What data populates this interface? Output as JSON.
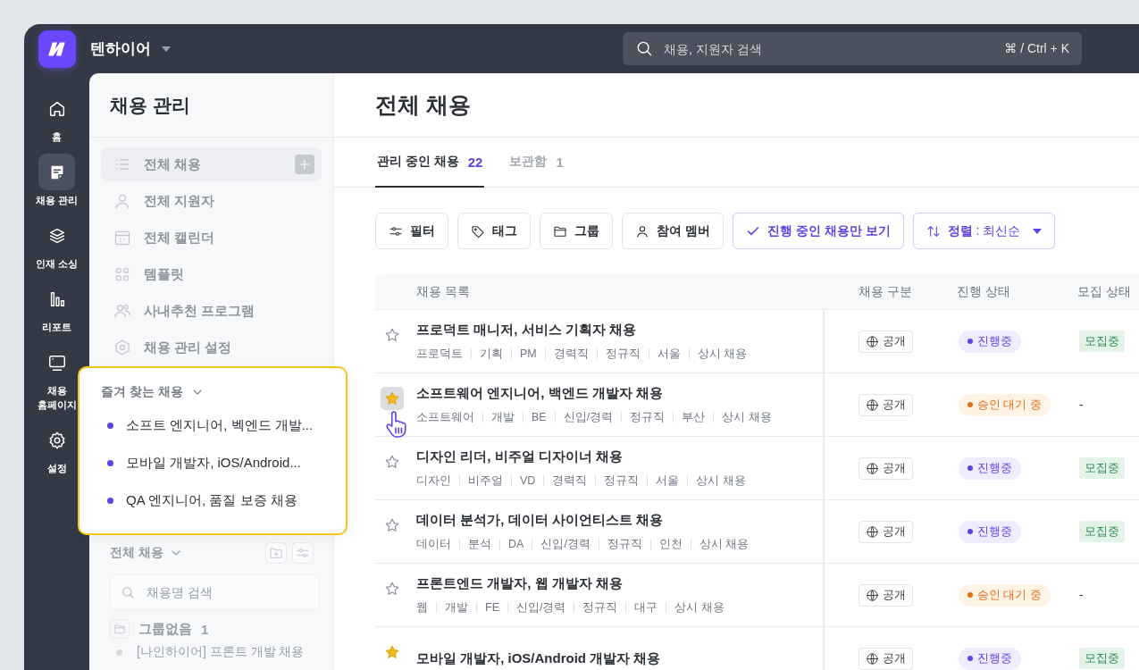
{
  "topbar": {
    "workspace": "텐하이어",
    "search": {
      "placeholder": "채용, 지원자 검색",
      "shortcut": "⌘ / Ctrl + K"
    }
  },
  "rail": [
    {
      "label": "홈",
      "selected": false
    },
    {
      "label": "채용 관리",
      "selected": true
    },
    {
      "label": "인재 소싱",
      "selected": false
    },
    {
      "label": "리포트",
      "selected": false
    },
    {
      "label": "채용 홈페이지",
      "selected": false
    },
    {
      "label": "설정",
      "selected": false
    }
  ],
  "sidebar": {
    "title": "채용 관리",
    "items": [
      {
        "label": "전체 채용",
        "selected": true
      },
      {
        "label": "전체 지원자",
        "selected": false
      },
      {
        "label": "전체 캘린더",
        "selected": false
      },
      {
        "label": "템플릿",
        "selected": false
      },
      {
        "label": "사내추천 프로그램",
        "selected": false
      },
      {
        "label": "채용 관리 설정",
        "selected": false
      }
    ],
    "favorites": {
      "title": "즐겨 찾는 채용",
      "expanded": true,
      "items": [
        "소프트 엔지니어, 벡엔드 개발...",
        "모바일 개발자, iOS/Android...",
        "QA 엔지니어, 품질 보증 채용"
      ]
    },
    "all_jobs": {
      "title": "전체 채용",
      "search_placeholder": "채용명 검색",
      "groups": [
        {
          "label": "그룹없음",
          "count": "1",
          "children": [
            {
              "label": "[나인하이어] 프론트 개발 채용"
            }
          ]
        }
      ]
    }
  },
  "main": {
    "title": "전체 채용",
    "tabs": [
      {
        "label": "관리 중인 채용",
        "count": "22",
        "selected": true
      },
      {
        "label": "보관함",
        "count": "1",
        "selected": false
      }
    ],
    "toolbar": [
      {
        "kind": "plain",
        "label": "필터"
      },
      {
        "kind": "plain",
        "label": "태그"
      },
      {
        "kind": "plain",
        "label": "그룹"
      },
      {
        "kind": "plain",
        "label": "참여 멤버"
      },
      {
        "kind": "toggle",
        "label": "진행 중인 채용만 보기",
        "checked": true
      },
      {
        "kind": "sort",
        "label": "**정렬** : 최신순"
      }
    ],
    "table": {
      "columns": [
        "채용 목록",
        "채용 구분",
        "진행 상태",
        "모집 상태"
      ],
      "rows": [
        {
          "starred": false,
          "hovered": false,
          "title": "프로덕트 매니저, 서비스 기획자 채용",
          "tags": [
            "프로덕트",
            "기획",
            "PM",
            "경력직",
            "정규직",
            "서울",
            "상시 채용"
          ],
          "visibility": "공개",
          "progress": {
            "kind": "active",
            "label": "진행중"
          },
          "recruit": {
            "kind": "badge",
            "label": "모집중"
          }
        },
        {
          "starred": true,
          "hovered": true,
          "title": "소프트웨어 엔지니어, 백엔드 개발자 채용",
          "tags": [
            "소프트웨어",
            "개발",
            "BE",
            "신입/경력",
            "정규직",
            "부산",
            "상시 채용"
          ],
          "visibility": "공개",
          "progress": {
            "kind": "pending",
            "label": "승인 대기 중"
          },
          "recruit": {
            "kind": "none",
            "label": "-"
          }
        },
        {
          "starred": false,
          "hovered": false,
          "title": "디자인 리더, 비주얼 디자이너 채용",
          "tags": [
            "디자인",
            "비주얼",
            "VD",
            "경력직",
            "정규직",
            "서울",
            "상시 채용"
          ],
          "visibility": "공개",
          "progress": {
            "kind": "active",
            "label": "진행중"
          },
          "recruit": {
            "kind": "badge",
            "label": "모집중"
          }
        },
        {
          "starred": false,
          "hovered": false,
          "title": "데이터 분석가, 데이터 사이언티스트 채용",
          "tags": [
            "데이터",
            "분석",
            "DA",
            "신입/경력",
            "정규직",
            "인천",
            "상시 채용"
          ],
          "visibility": "공개",
          "progress": {
            "kind": "active",
            "label": "진행중"
          },
          "recruit": {
            "kind": "badge",
            "label": "모집중"
          }
        },
        {
          "starred": false,
          "hovered": false,
          "title": "프론트엔드 개발자, 웹 개발자 채용",
          "tags": [
            "웹",
            "개발",
            "FE",
            "신입/경력",
            "정규직",
            "대구",
            "상시 채용"
          ],
          "visibility": "공개",
          "progress": {
            "kind": "pending",
            "label": "승인 대기 중"
          },
          "recruit": {
            "kind": "none",
            "label": "-"
          }
        },
        {
          "starred": true,
          "hovered": false,
          "title": "모바일 개발자, iOS/Android 개발자 채용",
          "visibility": "공개",
          "progress": {
            "kind": "active",
            "label": "진행중"
          },
          "recruit": {
            "kind": "badge",
            "label": "모집중"
          }
        }
      ]
    }
  }
}
